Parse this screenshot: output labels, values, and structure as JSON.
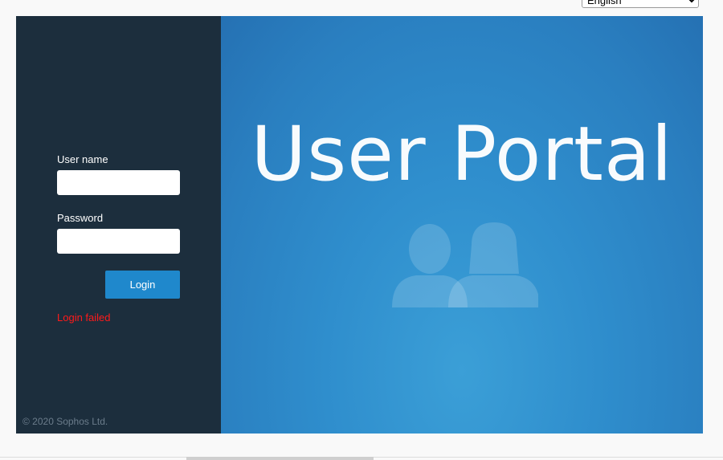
{
  "language_select": {
    "selected": "English",
    "options": [
      "English"
    ]
  },
  "login_form": {
    "username_label": "User name",
    "username_value": "",
    "password_label": "Password",
    "password_value": "",
    "login_button": "Login",
    "error_message": "Login failed"
  },
  "footer": {
    "copyright": "© 2020 Sophos Ltd."
  },
  "hero": {
    "title": "User Portal",
    "icon": "users-icon"
  },
  "colors": {
    "left_panel": "#1c2e3d",
    "accent": "#1f88cc",
    "error": "#ff1a1a",
    "hero_blue": "#2f8ecd"
  }
}
